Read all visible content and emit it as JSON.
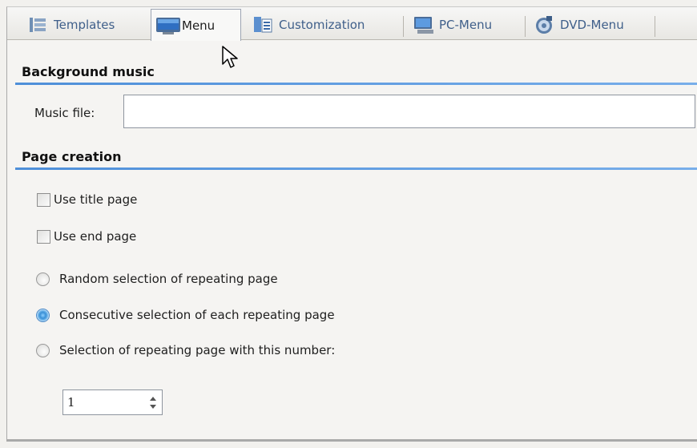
{
  "tabs": [
    {
      "label": "Templates",
      "icon": "templates-icon"
    },
    {
      "label": "Menu",
      "icon": "menu-monitor-icon",
      "active": true
    },
    {
      "label": "Customization",
      "icon": "customization-icon"
    },
    {
      "label": "PC-Menu",
      "icon": "pc-menu-icon"
    },
    {
      "label": "DVD-Menu",
      "icon": "dvd-menu-icon"
    }
  ],
  "background_music": {
    "title": "Background music",
    "music_file_label": "Music file:",
    "music_file_value": ""
  },
  "page_creation": {
    "title": "Page creation",
    "use_title_page": {
      "label": "Use title page",
      "checked": false
    },
    "use_end_page": {
      "label": "Use end page",
      "checked": false
    },
    "radio_options": [
      {
        "label": "Random selection of repeating page",
        "checked": false
      },
      {
        "label": "Consecutive selection of each repeating page",
        "checked": true
      },
      {
        "label": "Selection of repeating page with this number:",
        "checked": false
      }
    ],
    "page_number": "1"
  },
  "colors": {
    "accent_line": "#4e8fd9",
    "tab_text": "#3f5f8a",
    "radio_selected": "#3a90d6"
  }
}
